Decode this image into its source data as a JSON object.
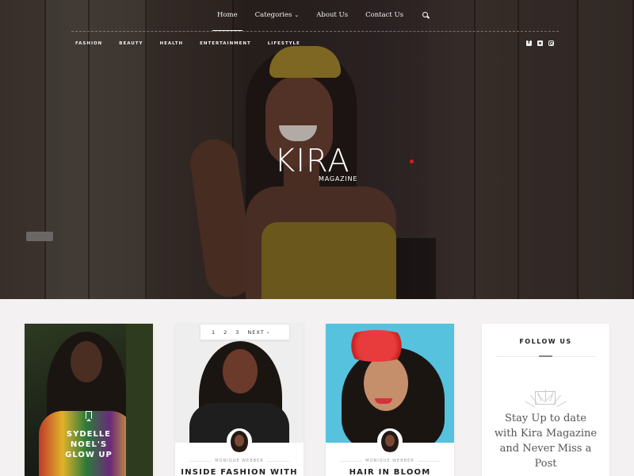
{
  "nav": {
    "items": [
      {
        "label": "Home",
        "active": true
      },
      {
        "label": "Categories",
        "has_dropdown": true
      },
      {
        "label": "About Us"
      },
      {
        "label": "Contact Us"
      }
    ],
    "search_icon": "search-icon"
  },
  "categories": [
    "FASHION",
    "BEAUTY",
    "HEALTH",
    "ENTERTAINMENT",
    "LIFESTYLE"
  ],
  "social": [
    "facebook-icon",
    "twitter-icon",
    "instagram-icon"
  ],
  "logo": {
    "main": "KIRA",
    "sub": "MAGAZINE"
  },
  "accent_color": "#d21f1f",
  "pagination": {
    "pages": [
      "1",
      "2",
      "3"
    ],
    "next": "NEXT ›"
  },
  "posts": [
    {
      "title": "SYDELLE NOEL'S GLOW UP",
      "title_lines": [
        "SYDELLE",
        "NOEL'S",
        "GLOW UP"
      ],
      "icon": "bookmark-icon"
    },
    {
      "author": "MONIQUE WEBBER",
      "title": "INSIDE FASHION WITH"
    },
    {
      "author": "MONIQUE WEBBER",
      "title": "HAIR IN BLOOM"
    }
  ],
  "follow": {
    "title": "FOLLOW US",
    "icon": "envelope-icon",
    "text": "Stay Up to date with Kira Magazine and Never Miss a Post"
  }
}
